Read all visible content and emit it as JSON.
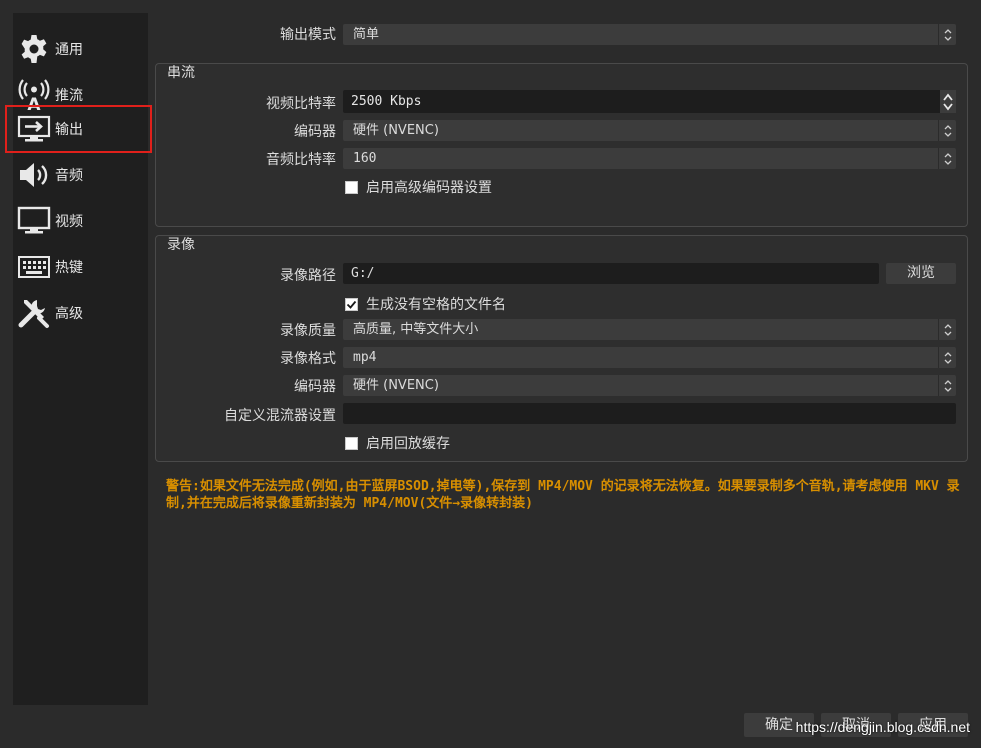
{
  "sidebar": {
    "items": [
      {
        "label": "通用",
        "icon": "gear-icon"
      },
      {
        "label": "推流",
        "icon": "broadcast-icon"
      },
      {
        "label": "输出",
        "icon": "output-icon",
        "selected": true
      },
      {
        "label": "音频",
        "icon": "speaker-icon"
      },
      {
        "label": "视频",
        "icon": "monitor-icon"
      },
      {
        "label": "热键",
        "icon": "keyboard-icon"
      },
      {
        "label": "高级",
        "icon": "tools-icon"
      }
    ],
    "selected_outline_color": "#e0201b"
  },
  "output_mode": {
    "label": "输出模式",
    "value": "简单"
  },
  "streaming": {
    "title": "串流",
    "video_bitrate": {
      "label": "视频比特率",
      "value": "2500 Kbps"
    },
    "encoder": {
      "label": "编码器",
      "value": "硬件 (NVENC)"
    },
    "audio_bitrate": {
      "label": "音频比特率",
      "value": "160"
    },
    "advanced_encoder": {
      "label": "启用高级编码器设置",
      "checked": false
    }
  },
  "recording": {
    "title": "录像",
    "path": {
      "label": "录像路径",
      "value": "G:/",
      "browse": "浏览"
    },
    "no_space_filename": {
      "label": "生成没有空格的文件名",
      "checked": true
    },
    "quality": {
      "label": "录像质量",
      "value": "高质量, 中等文件大小"
    },
    "format": {
      "label": "录像格式",
      "value": "mp4"
    },
    "encoder": {
      "label": "编码器",
      "value": "硬件 (NVENC)"
    },
    "muxer": {
      "label": "自定义混流器设置",
      "value": ""
    },
    "replay_buffer": {
      "label": "启用回放缓存",
      "checked": false
    }
  },
  "warning": {
    "text": "警告:如果文件无法完成(例如,由于蓝屏BSOD,掉电等),保存到 MP4/MOV 的记录将无法恢复。如果要录制多个音轨,请考虑使用 MKV 录制,并在完成后将录像重新封装为 MP4/MOV(文件→录像转封装)",
    "color": "#d88f00"
  },
  "footer": {
    "ok": "确定",
    "cancel": "取消",
    "apply": "应用"
  },
  "watermark": "https://dengjin.blog.csdn.net"
}
